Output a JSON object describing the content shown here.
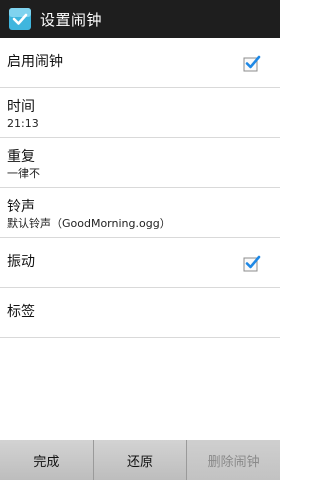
{
  "header": {
    "title": "设置闹钟"
  },
  "settings": {
    "enable_alarm": {
      "label": "启用闹钟",
      "checked": true
    },
    "time": {
      "label": "时间",
      "value": "21:13"
    },
    "repeat": {
      "label": "重复",
      "value": "一律不"
    },
    "ringtone": {
      "label": "铃声",
      "value": "默认铃声（GoodMorning.ogg）"
    },
    "vibrate": {
      "label": "振动",
      "checked": true
    },
    "tag": {
      "label": "标签"
    }
  },
  "buttons": {
    "done": "完成",
    "revert": "还原",
    "delete": "删除闹钟"
  },
  "colors": {
    "title_bar": "#1e1e1e",
    "check_accent": "#1e88e5"
  }
}
